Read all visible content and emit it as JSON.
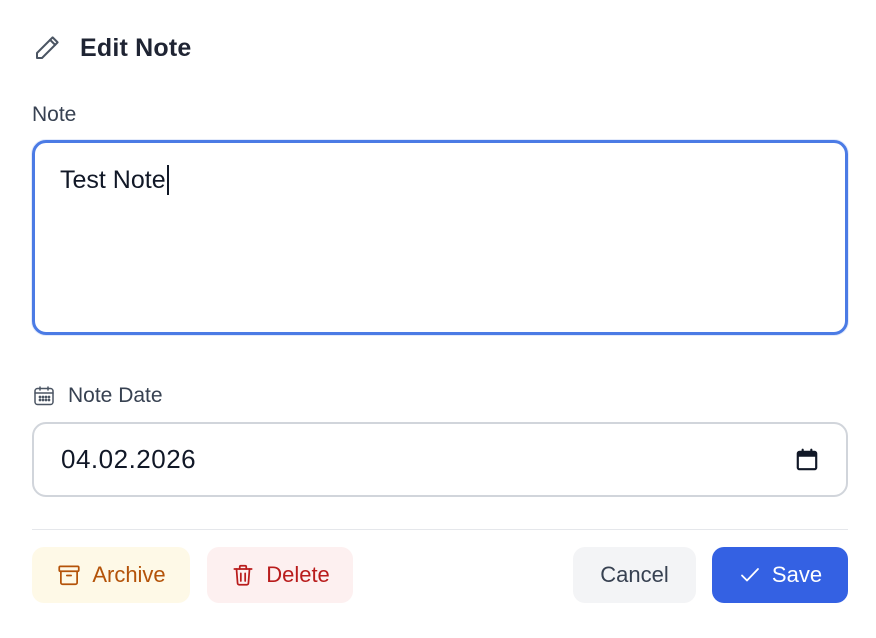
{
  "header": {
    "title": "Edit Note",
    "icon": "pencil-icon"
  },
  "note_field": {
    "label": "Note",
    "value": "Test Note",
    "focus_color": "#4b7be5"
  },
  "date_field": {
    "label": "Note Date",
    "label_icon": "calendar-icon",
    "value": "04.02.2026",
    "picker_icon": "calendar-picker-icon"
  },
  "actions": {
    "archive_label": "Archive",
    "archive_icon": "archive-box-icon",
    "delete_label": "Delete",
    "delete_icon": "trash-icon",
    "cancel_label": "Cancel",
    "save_label": "Save",
    "save_icon": "check-icon",
    "colors": {
      "archive_bg": "#fef9e7",
      "archive_fg": "#b45309",
      "delete_bg": "#fdf0f0",
      "delete_fg": "#b91c1c",
      "cancel_bg": "#f3f4f6",
      "save_bg": "#3461e3"
    }
  }
}
